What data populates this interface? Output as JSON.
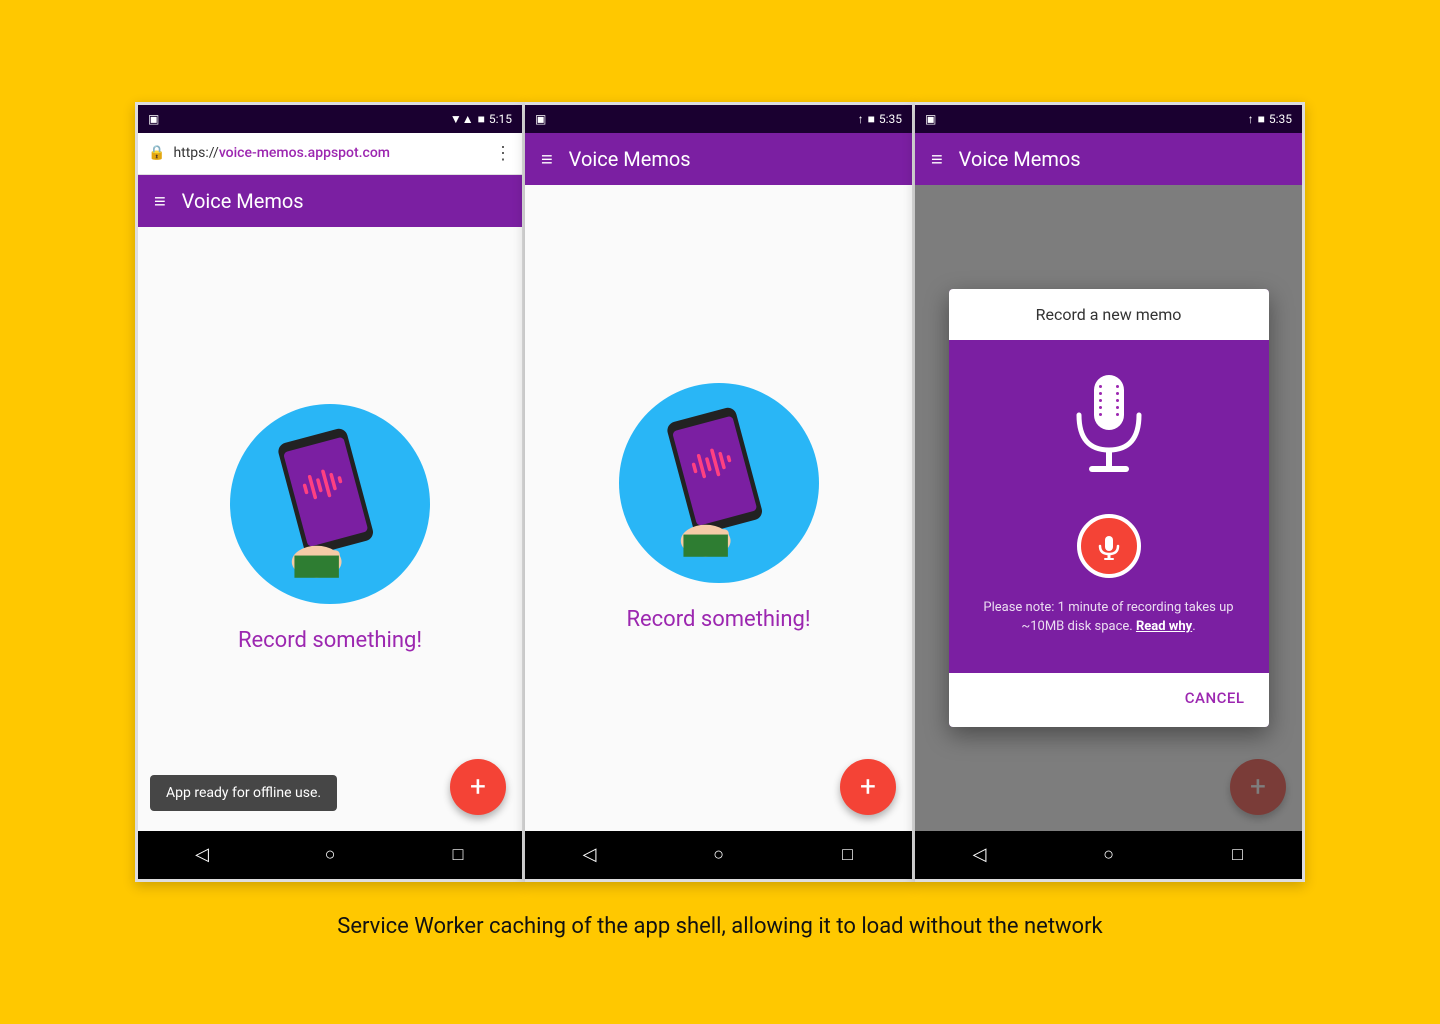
{
  "page": {
    "background_color": "#FFC800",
    "caption": "Service Worker caching of the app shell, allowing it to load without the network"
  },
  "phone1": {
    "status_bar": {
      "left_icon": "☐",
      "signal": "▼▲",
      "signal_bars": "▲",
      "battery": "■",
      "time": "5:15"
    },
    "url_bar": {
      "url": "https://voice-memos.appspot.com",
      "url_bold": "voice-memos.appspot.com"
    },
    "header": {
      "title": "Voice Memos"
    },
    "content": {
      "record_label": "Record something!"
    },
    "snackbar": {
      "text": "App ready for offline use."
    },
    "fab": {
      "label": "+"
    },
    "nav": {
      "back": "◁",
      "home": "○",
      "recent": "□"
    }
  },
  "phone2": {
    "status_bar": {
      "left_icon": "☐",
      "arrow": "↑",
      "battery": "■",
      "time": "5:35"
    },
    "header": {
      "title": "Voice Memos"
    },
    "content": {
      "record_label": "Record something!"
    },
    "fab": {
      "label": "+"
    },
    "nav": {
      "back": "◁",
      "home": "○",
      "recent": "□"
    }
  },
  "phone3": {
    "status_bar": {
      "left_icon": "☐",
      "arrow": "↑",
      "battery": "■",
      "time": "5:35"
    },
    "header": {
      "title": "Voice Memos"
    },
    "dialog": {
      "title": "Record a new memo",
      "note": "Please note: 1 minute of recording takes up ~10MB disk space.",
      "note_link": "Read why",
      "cancel_btn": "CANCEL"
    },
    "fab": {
      "label": "+"
    },
    "nav": {
      "back": "◁",
      "home": "○",
      "recent": "□"
    }
  }
}
